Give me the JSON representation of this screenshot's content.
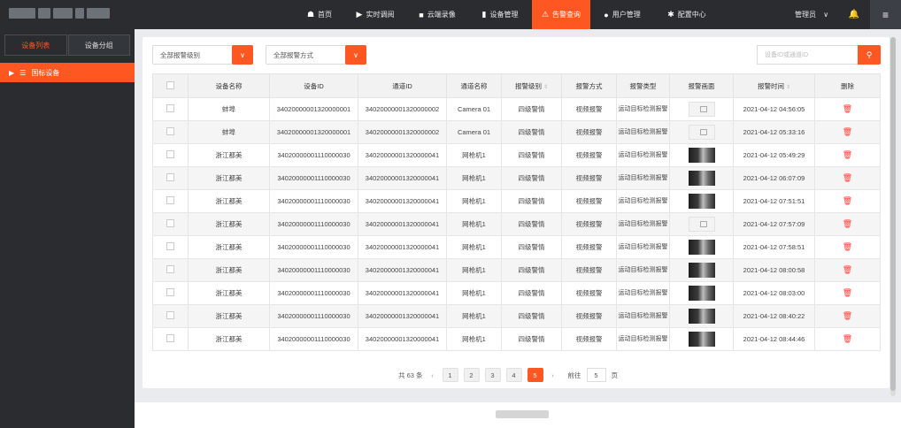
{
  "nav": {
    "items": [
      {
        "icon": "home-icon",
        "glyph": "☗",
        "label": "首页",
        "active": false
      },
      {
        "icon": "play-icon",
        "glyph": "▶",
        "label": "实时调阅",
        "active": false
      },
      {
        "icon": "video-camera-icon",
        "glyph": "■",
        "label": "云端录像",
        "active": false
      },
      {
        "icon": "device-icon",
        "glyph": "▮",
        "label": "设备管理",
        "active": false
      },
      {
        "icon": "alarm-icon",
        "glyph": "⚠",
        "label": "告警查询",
        "active": true
      },
      {
        "icon": "user-icon",
        "glyph": "●",
        "label": "用户管理",
        "active": false
      },
      {
        "icon": "gear-icon",
        "glyph": "✱",
        "label": "配置中心",
        "active": false
      }
    ],
    "admin_label": "管理员",
    "admin_caret": "∨",
    "bell_glyph": "🔔",
    "menu_glyph": "≡"
  },
  "sidebar": {
    "tabs": [
      {
        "label": "设备列表",
        "active": true
      },
      {
        "label": "设备分组",
        "active": false
      }
    ],
    "tree_item": "国标设备"
  },
  "filters": {
    "level_placeholder": "全部报警级别",
    "method_placeholder": "全部报警方式",
    "search_placeholder": "设备ID或通道ID"
  },
  "table": {
    "headers": {
      "device_name": "设备名称",
      "device_id": "设备ID",
      "channel_id": "通道ID",
      "channel_name": "通道名称",
      "alarm_level": "报警级别",
      "alarm_method": "报警方式",
      "alarm_type": "报警类型",
      "alarm_image": "报警画面",
      "alarm_time": "报警时间",
      "delete": "删除"
    },
    "rows": [
      {
        "device_name": "蚌埠",
        "device_id": "34020000001320000001",
        "channel_id": "34020000001320000002",
        "channel_name": "Camera 01",
        "level": "四级警情",
        "method": "视频报警",
        "type": "运动目标检测报警",
        "image": "blank",
        "time": "2021-04-12 04:56:05"
      },
      {
        "device_name": "蚌埠",
        "device_id": "34020000001320000001",
        "channel_id": "34020000001320000002",
        "channel_name": "Camera 01",
        "level": "四级警情",
        "method": "视频报警",
        "type": "运动目标检测报警",
        "image": "blank",
        "time": "2021-04-12 05:33:16"
      },
      {
        "device_name": "浙江都美",
        "device_id": "34020000001110000030",
        "channel_id": "34020000001320000041",
        "channel_name": "网枪机1",
        "level": "四级警情",
        "method": "视频报警",
        "type": "运动目标检测报警",
        "image": "dark",
        "time": "2021-04-12 05:49:29"
      },
      {
        "device_name": "浙江都美",
        "device_id": "34020000001110000030",
        "channel_id": "34020000001320000041",
        "channel_name": "网枪机1",
        "level": "四级警情",
        "method": "视频报警",
        "type": "运动目标检测报警",
        "image": "dark",
        "time": "2021-04-12 06:07:09"
      },
      {
        "device_name": "浙江都美",
        "device_id": "34020000001110000030",
        "channel_id": "34020000001320000041",
        "channel_name": "网枪机1",
        "level": "四级警情",
        "method": "视频报警",
        "type": "运动目标检测报警",
        "image": "dark",
        "time": "2021-04-12 07:51:51"
      },
      {
        "device_name": "浙江都美",
        "device_id": "34020000001110000030",
        "channel_id": "34020000001320000041",
        "channel_name": "网枪机1",
        "level": "四级警情",
        "method": "视频报警",
        "type": "运动目标检测报警",
        "image": "blank",
        "time": "2021-04-12 07:57:09"
      },
      {
        "device_name": "浙江都美",
        "device_id": "34020000001110000030",
        "channel_id": "34020000001320000041",
        "channel_name": "网枪机1",
        "level": "四级警情",
        "method": "视频报警",
        "type": "运动目标检测报警",
        "image": "dark",
        "time": "2021-04-12 07:58:51"
      },
      {
        "device_name": "浙江都美",
        "device_id": "34020000001110000030",
        "channel_id": "34020000001320000041",
        "channel_name": "网枪机1",
        "level": "四级警情",
        "method": "视频报警",
        "type": "运动目标检测报警",
        "image": "dark",
        "time": "2021-04-12 08:00:58"
      },
      {
        "device_name": "浙江都美",
        "device_id": "34020000001110000030",
        "channel_id": "34020000001320000041",
        "channel_name": "网枪机1",
        "level": "四级警情",
        "method": "视频报警",
        "type": "运动目标检测报警",
        "image": "dark",
        "time": "2021-04-12 08:03:00"
      },
      {
        "device_name": "浙江都美",
        "device_id": "34020000001110000030",
        "channel_id": "34020000001320000041",
        "channel_name": "网枪机1",
        "level": "四级警情",
        "method": "视频报警",
        "type": "运动目标检测报警",
        "image": "dark",
        "time": "2021-04-12 08:40:22"
      },
      {
        "device_name": "浙江都美",
        "device_id": "34020000001110000030",
        "channel_id": "34020000001320000041",
        "channel_name": "网枪机1",
        "level": "四级警情",
        "method": "视频报警",
        "type": "运动目标检测报警",
        "image": "dark",
        "time": "2021-04-12 08:44:46"
      }
    ]
  },
  "pagination": {
    "total_text": "共 63 条",
    "pages": [
      "1",
      "2",
      "3",
      "4",
      "5"
    ],
    "current_page": "5",
    "goto_label": "前往",
    "goto_value": "5",
    "page_suffix": "页"
  },
  "colors": {
    "accent": "#ff5722",
    "nav_bg": "#2a2c30",
    "delete_icon": "#ff3b30"
  }
}
